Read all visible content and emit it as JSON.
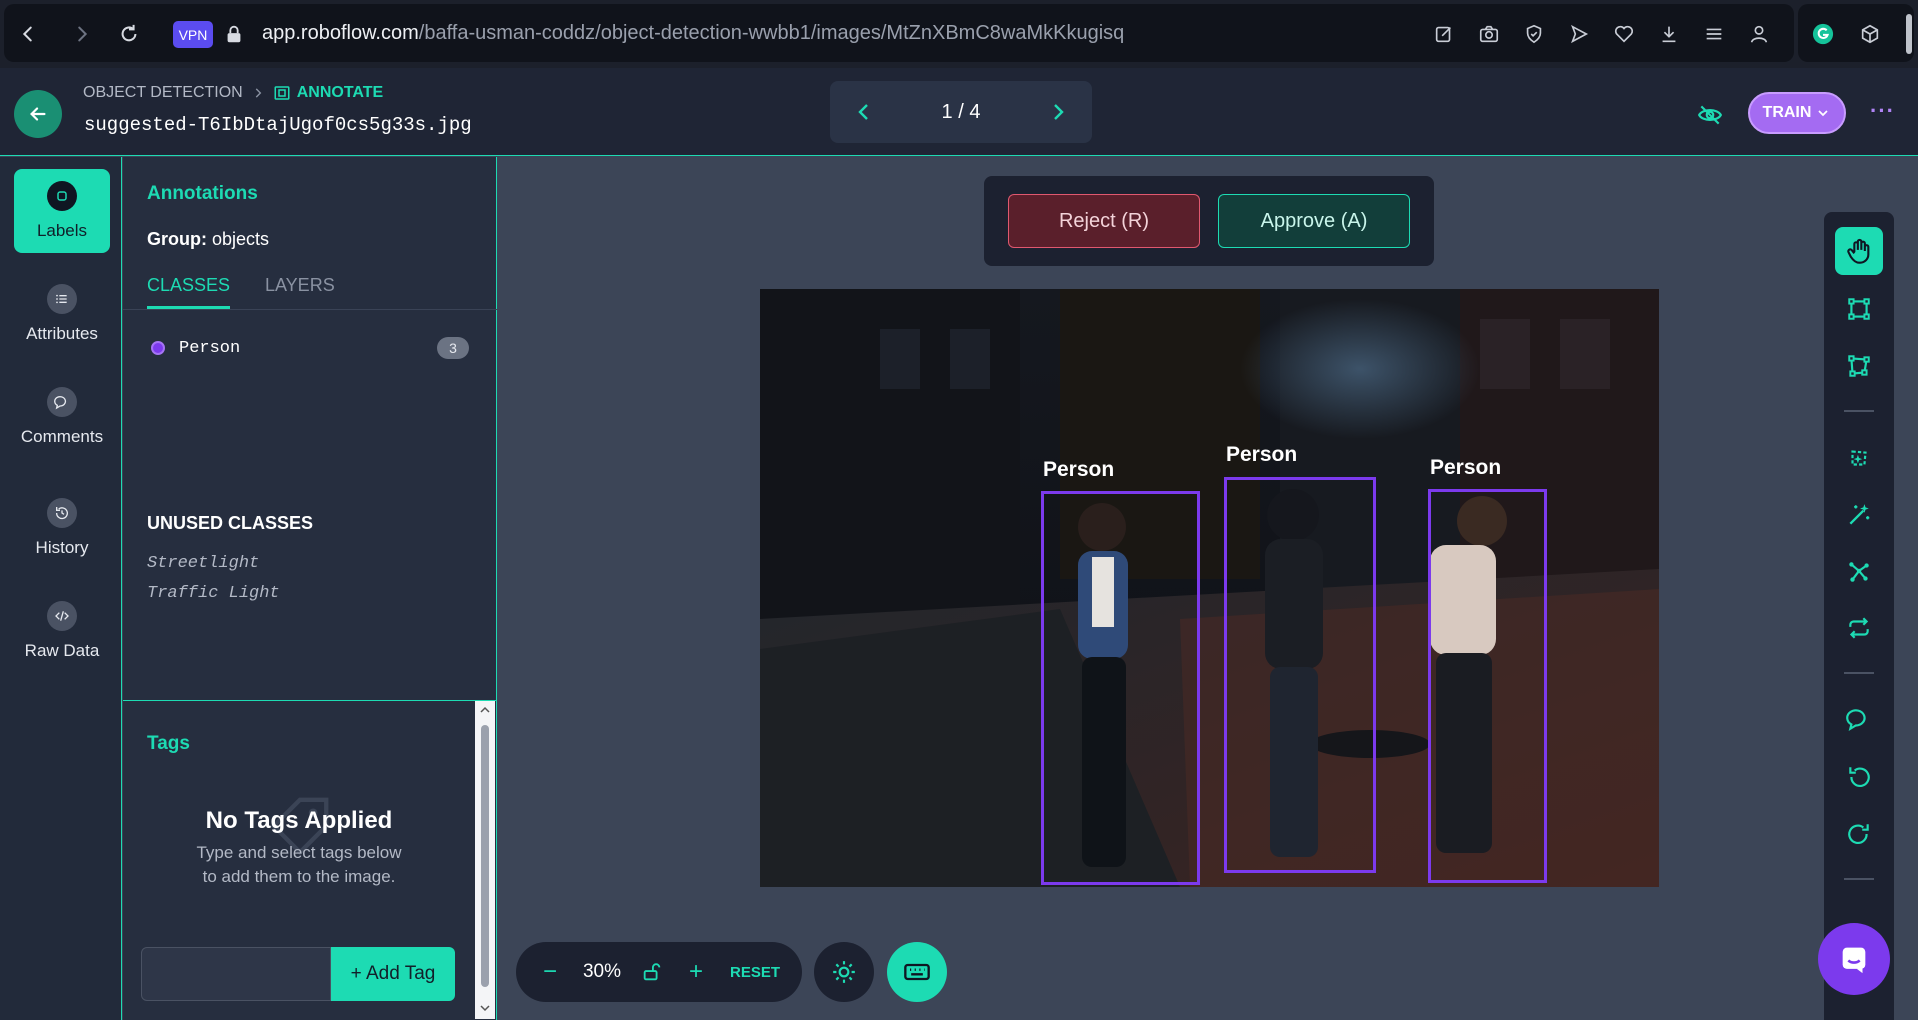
{
  "browser": {
    "vpn_label": "VPN",
    "url_domain": "app.roboflow.com",
    "url_path": "/baffa-usman-coddz/object-detection-wwbb1/images/MtZnXBmC8waMkKkugisq"
  },
  "header": {
    "breadcrumb_project": "OBJECT DETECTION",
    "breadcrumb_current": "ANNOTATE",
    "filename": "suggested-T6IbDtajUgof0cs5g33s.jpg",
    "pager_text": "1 / 4",
    "train_label": "TRAIN",
    "more_label": "···"
  },
  "leftnav": {
    "items": [
      {
        "label": "Labels",
        "icon": "tag-icon",
        "active": true
      },
      {
        "label": "Attributes",
        "icon": "list-icon",
        "active": false
      },
      {
        "label": "Comments",
        "icon": "comment-icon",
        "active": false
      },
      {
        "label": "History",
        "icon": "history-icon",
        "active": false
      },
      {
        "label": "Raw Data",
        "icon": "code-icon",
        "active": false
      }
    ]
  },
  "annotations": {
    "title": "Annotations",
    "group_label": "Group:",
    "group_value": "objects",
    "tabs": [
      "CLASSES",
      "LAYERS"
    ],
    "classes": [
      {
        "name": "Person",
        "count": "3",
        "color": "#7c3aed"
      }
    ],
    "unused_title": "UNUSED CLASSES",
    "unused_classes": [
      "Streetlight",
      "Traffic Light"
    ]
  },
  "tags": {
    "title": "Tags",
    "empty_title": "No Tags Applied",
    "hint_line1": "Type and select tags below",
    "hint_line2": "to add them to the image.",
    "input_value": "",
    "add_label": "+ Add Tag"
  },
  "review": {
    "reject_label": "Reject (R)",
    "approve_label": "Approve (A)"
  },
  "canvas": {
    "boxes": [
      {
        "label": "Person"
      },
      {
        "label": "Person"
      },
      {
        "label": "Person"
      }
    ]
  },
  "zoom": {
    "minus": "−",
    "value": "30%",
    "plus": "+",
    "reset": "RESET"
  },
  "colors": {
    "accent": "#1ddbb3",
    "bbox": "#7c3aed",
    "train": "#a46bf2",
    "reject": "#e0586f"
  }
}
